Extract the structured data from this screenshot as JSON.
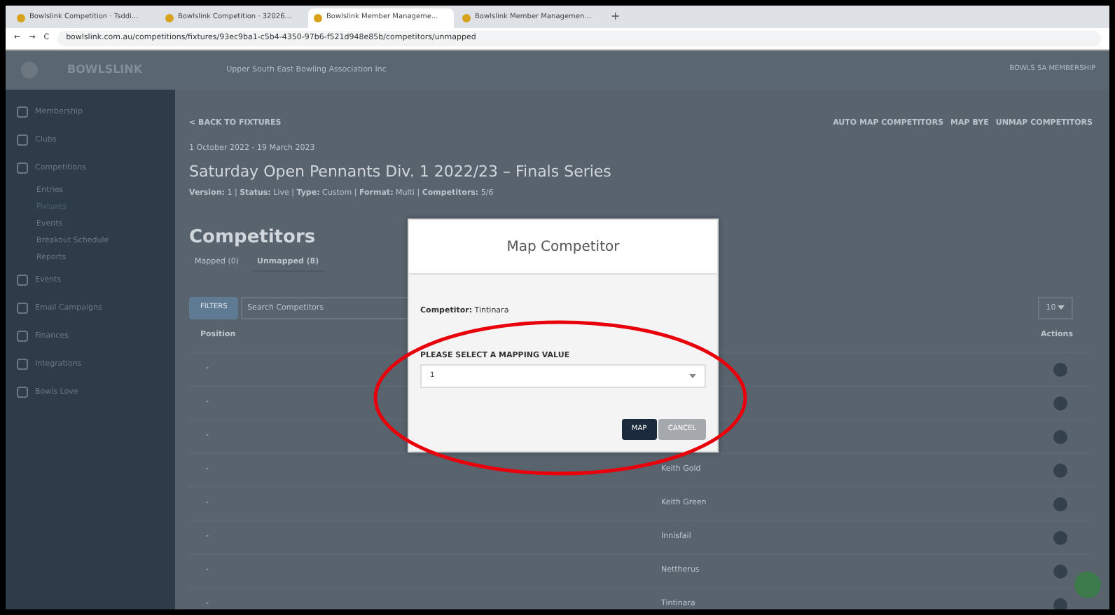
{
  "browser": {
    "tabs": [
      {
        "label": "Bowlslink Competition · Tsddi...",
        "selected": false
      },
      {
        "label": "Bowlslink Competition · 32026...",
        "selected": false
      },
      {
        "label": "Bowlslink Member Manageme...",
        "selected": true
      },
      {
        "label": "Bowlslink Member Managemen...",
        "selected": false
      }
    ],
    "new_tab": "+",
    "nav": [
      "←",
      "→",
      "C"
    ],
    "address": "bowlslink.com.au/competitions/fixtures/93ec9ba1-c5b4-4350-97b6-f521d948e85b/competitors/unmapped"
  },
  "header": {
    "logo": "BOWLSLINK",
    "organisation": "Upper South East Bowling Association Inc",
    "membership": "BOWLS SA MEMBERSHIP"
  },
  "sidebar": {
    "items": [
      {
        "label": "Membership"
      },
      {
        "label": "Clubs"
      },
      {
        "label": "Competitions",
        "children": [
          {
            "label": "Entries",
            "selected": false
          },
          {
            "label": "Fixtures",
            "selected": true
          },
          {
            "label": "Events",
            "selected": false
          },
          {
            "label": "Breakout Schedule",
            "selected": false
          },
          {
            "label": "Reports",
            "selected": false
          }
        ]
      },
      {
        "label": "Events"
      },
      {
        "label": "Email Campaigns"
      },
      {
        "label": "Finances"
      },
      {
        "label": "Integrations"
      },
      {
        "label": "Bowls Love"
      }
    ]
  },
  "page": {
    "back": "< BACK TO FIXTURES",
    "actions": [
      "AUTO MAP COMPETITORS",
      "MAP BYE",
      "UNMAP COMPETITORS"
    ],
    "dates": "1 October 2022 - 19 March 2023",
    "title": "Saturday Open Pennants Div. 1 2022/23 – Finals Series",
    "meta": "**Version:** 1 | **Status:** Live | **Type:** Custom | **Format:** Multi | **Competitors:** 5/6",
    "section": "Competitors",
    "tabs": [
      {
        "label": "Mapped (0)",
        "selected": false
      },
      {
        "label": "Unmapped (8)",
        "selected": true
      }
    ],
    "filters": "FILTERS",
    "search_placeholder": "Search Competitors",
    "per_page": "10",
    "columns": [
      "Position",
      "Actions"
    ],
    "rows": [
      {
        "position": "-"
      },
      {
        "position": "-"
      },
      {
        "position": "-"
      },
      {
        "position": "-",
        "name": "Keith Gold"
      },
      {
        "position": "-",
        "name": "Keith Green"
      },
      {
        "position": "-",
        "name": "Innisfail"
      },
      {
        "position": "-",
        "name": "Nettherus"
      },
      {
        "position": "-",
        "name": "Tintinara"
      }
    ]
  },
  "modal": {
    "title": "Map Competitor",
    "competitor": "**Competitor:** Tintinara",
    "select_label": "PLEASE SELECT A MAPPING VALUE",
    "select_value": "1",
    "buttons": [
      {
        "label": "MAP",
        "kind": "primary"
      },
      {
        "label": "CANCEL",
        "kind": "secondary"
      }
    ]
  }
}
